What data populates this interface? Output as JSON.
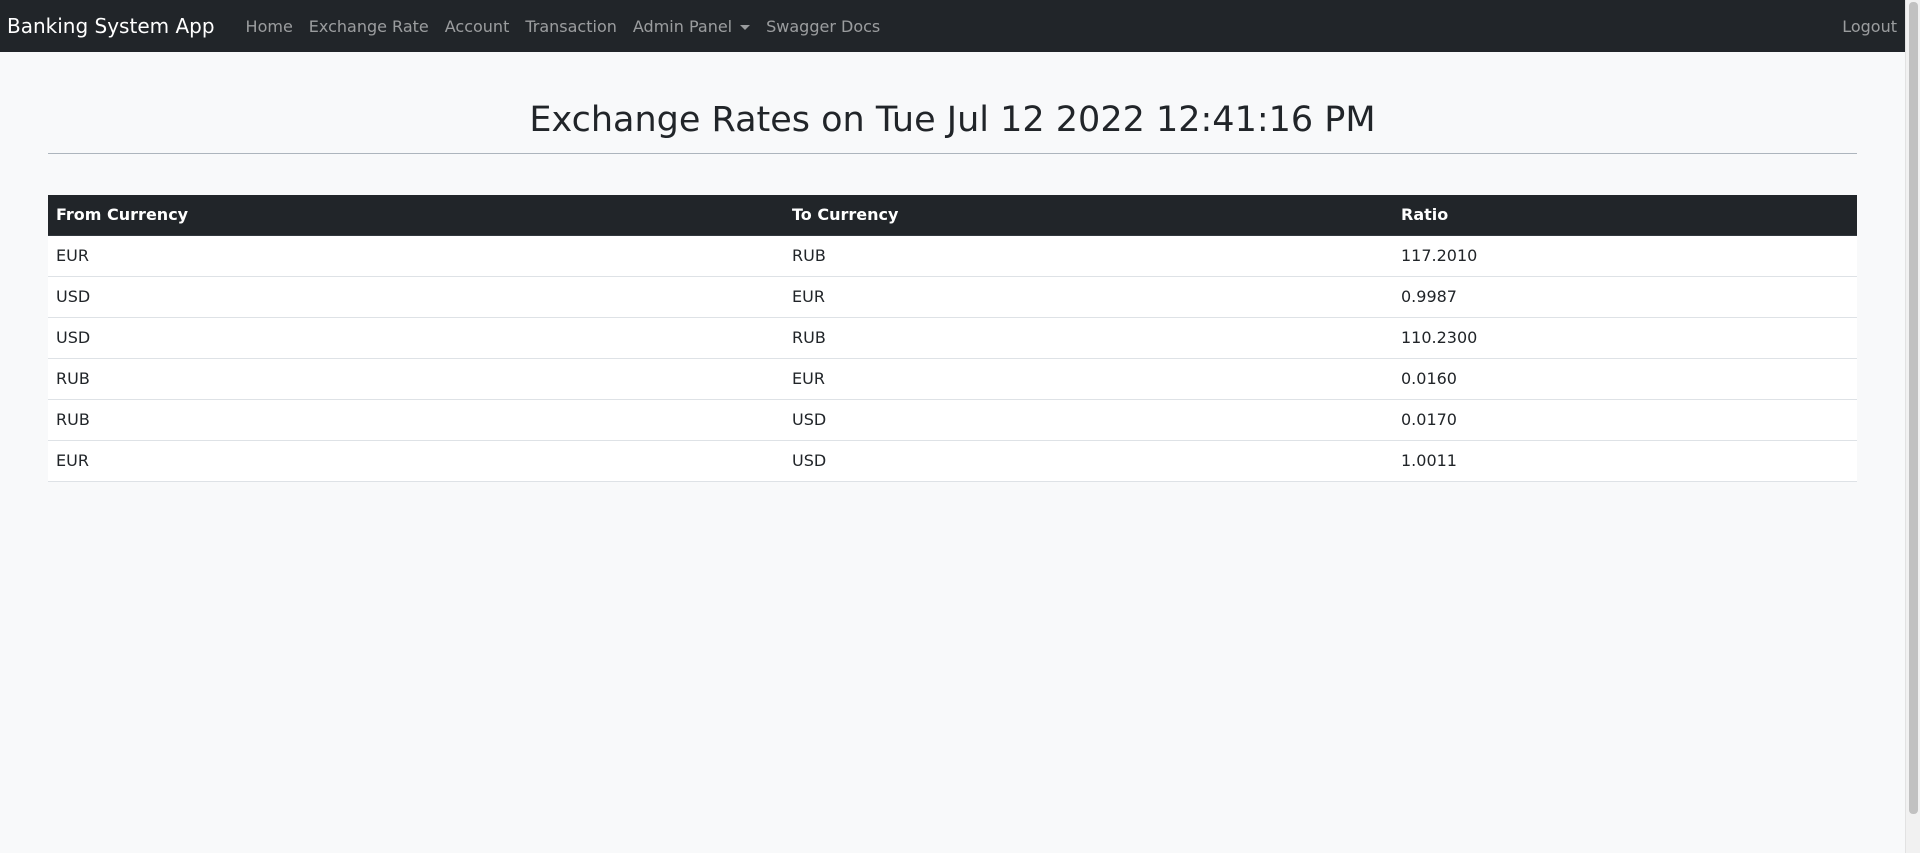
{
  "navbar": {
    "brand": "Banking System App",
    "items": [
      {
        "label": "Home"
      },
      {
        "label": "Exchange Rate"
      },
      {
        "label": "Account"
      },
      {
        "label": "Transaction"
      },
      {
        "label": "Admin Panel"
      },
      {
        "label": "Swagger Docs"
      }
    ],
    "logout": "Logout"
  },
  "page": {
    "title": "Exchange Rates on Tue Jul 12 2022 12:41:16 PM"
  },
  "table": {
    "headers": [
      "From Currency",
      "To Currency",
      "Ratio"
    ],
    "rows": [
      [
        "EUR",
        "RUB",
        "117.2010"
      ],
      [
        "USD",
        "EUR",
        "0.9987"
      ],
      [
        "USD",
        "RUB",
        "110.2300"
      ],
      [
        "RUB",
        "EUR",
        "0.0160"
      ],
      [
        "RUB",
        "USD",
        "0.0170"
      ],
      [
        "EUR",
        "USD",
        "1.0011"
      ]
    ]
  },
  "colors": {
    "navbar_bg": "#212529",
    "page_bg": "#f8f9fa",
    "header_bg": "#212529"
  }
}
